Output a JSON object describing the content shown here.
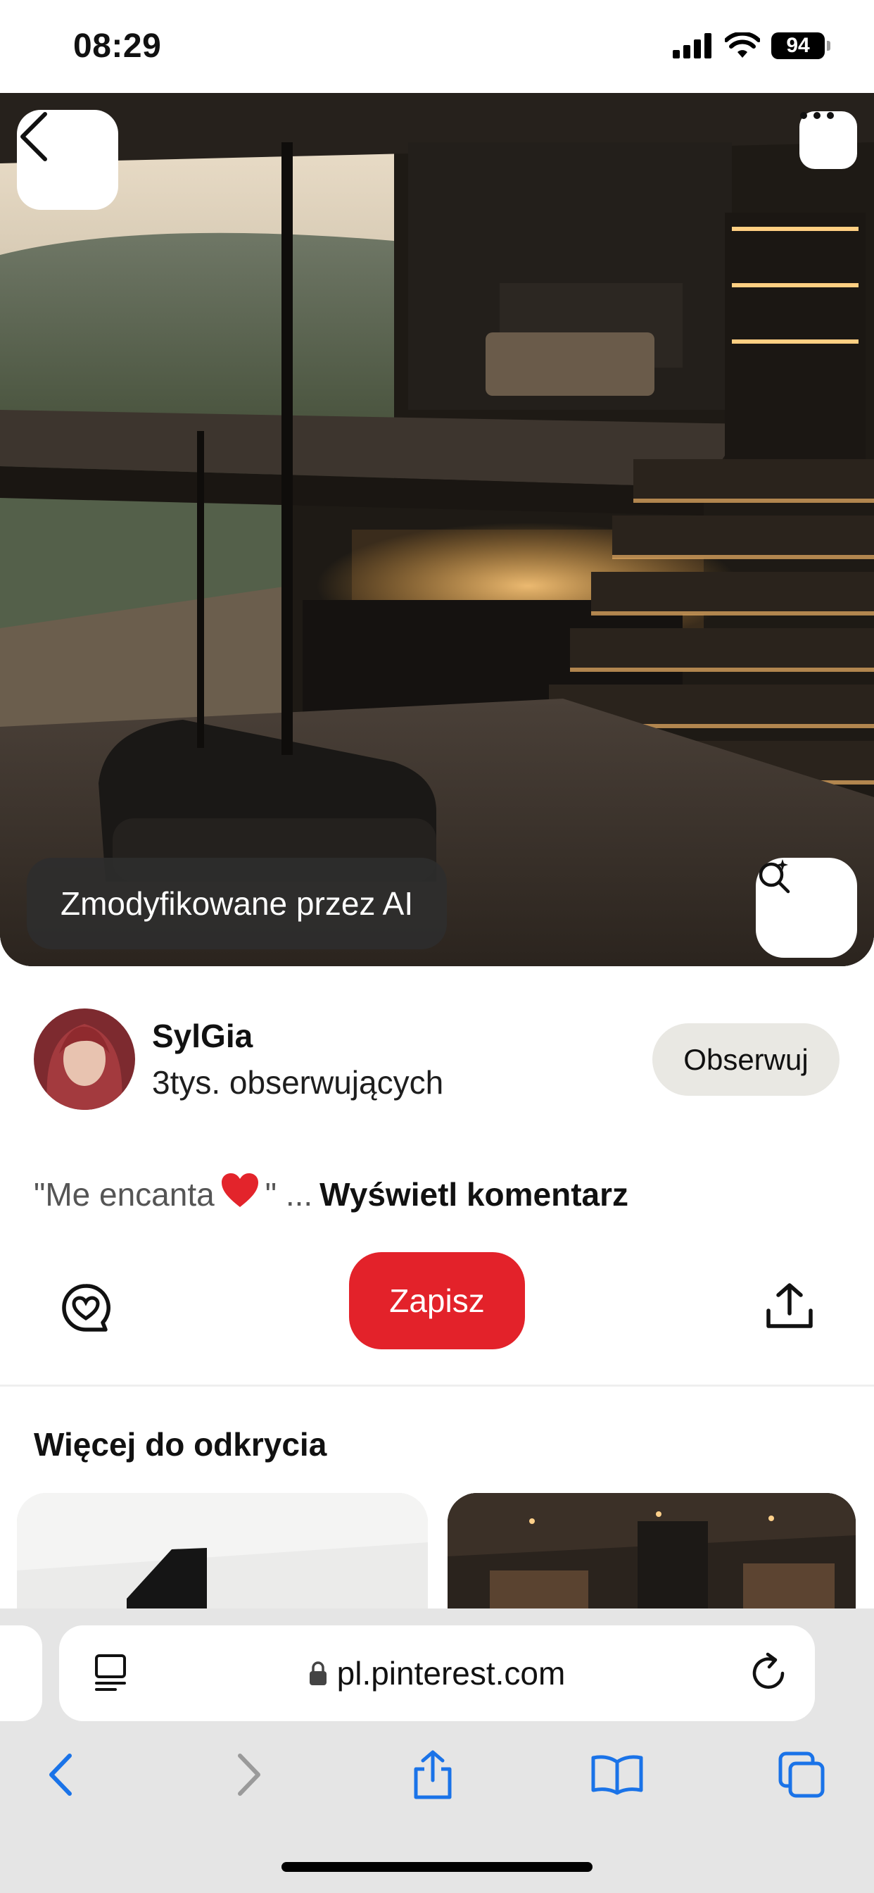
{
  "status_bar": {
    "time": "08:29",
    "battery": "94"
  },
  "pin": {
    "ai_badge": "Zmodyfikowane przez AI"
  },
  "creator": {
    "name": "SylGia",
    "followers": "3tys. obserwujących",
    "follow_label": "Obserwuj"
  },
  "comment": {
    "quote_open": "\"Me encanta",
    "emoji": "❤️",
    "quote_close": "\" ...",
    "link": "Wyświetl komentarz"
  },
  "actions": {
    "save_label": "Zapisz"
  },
  "more": {
    "title": "Więcej do odkrycia"
  },
  "browser": {
    "url": "pl.pinterest.com"
  },
  "colors": {
    "save": "#e3222a",
    "follow_bg": "#e9e8e3",
    "browser_accent": "#1a73e8"
  },
  "icons": [
    "back-chevron-icon",
    "more-dots-icon",
    "visual-search-icon",
    "comment-heart-icon",
    "share-upload-icon",
    "reader-icon",
    "lock-icon",
    "reload-icon",
    "back-icon",
    "forward-icon",
    "share-icon",
    "bookmarks-icon",
    "tabs-icon"
  ]
}
